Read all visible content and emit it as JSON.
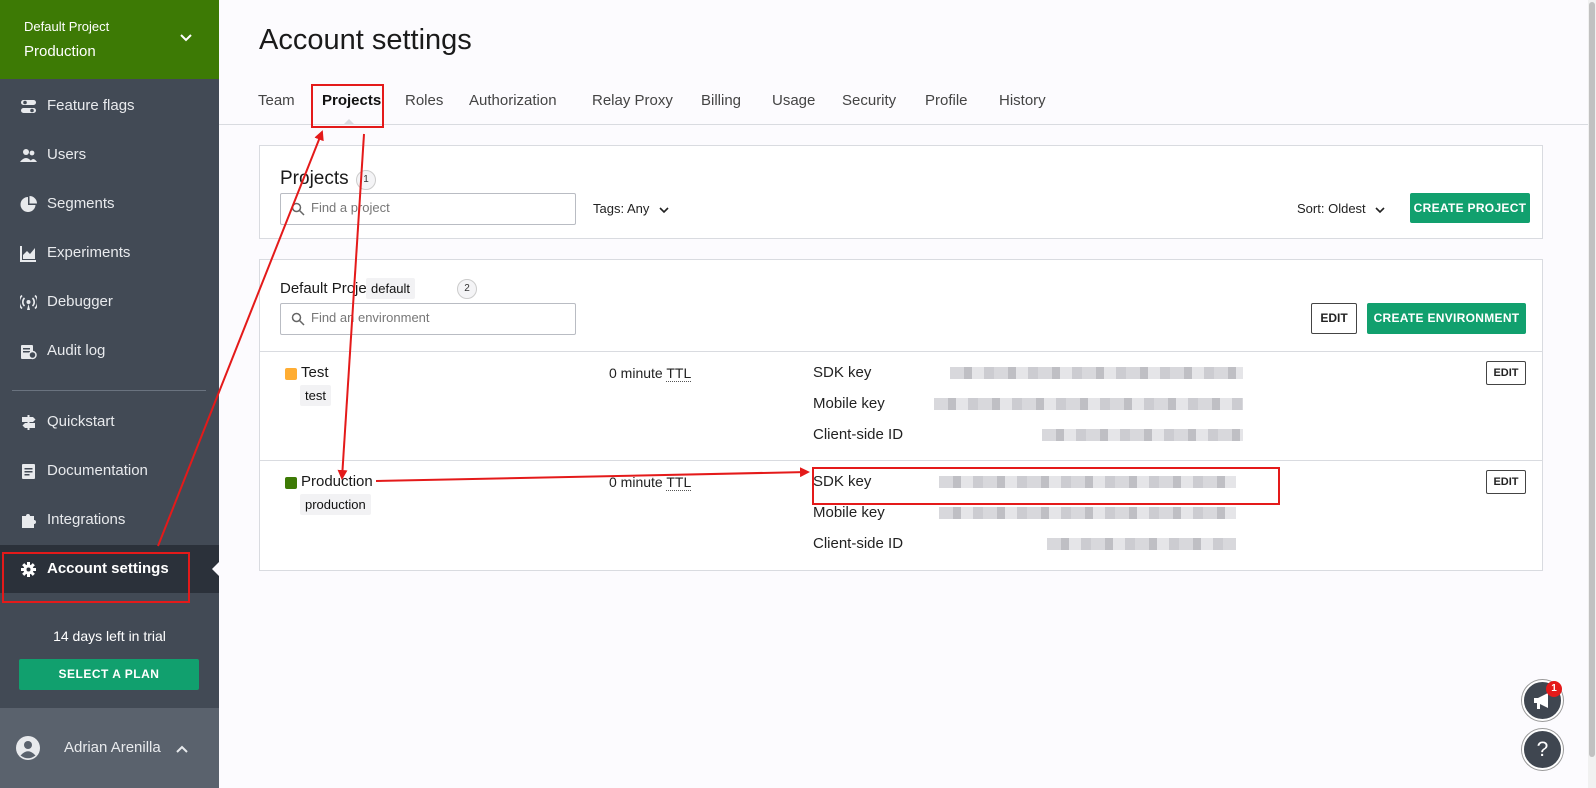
{
  "sidebar": {
    "project_name": "Default Project",
    "environment": "Production",
    "items": [
      {
        "label": "Feature flags",
        "icon": "toggle-icon"
      },
      {
        "label": "Users",
        "icon": "users-icon"
      },
      {
        "label": "Segments",
        "icon": "pie-chart-icon"
      },
      {
        "label": "Experiments",
        "icon": "chart-icon"
      },
      {
        "label": "Debugger",
        "icon": "broadcast-icon"
      },
      {
        "label": "Audit log",
        "icon": "audit-log-icon"
      },
      {
        "label": "Quickstart",
        "icon": "signpost-icon"
      },
      {
        "label": "Documentation",
        "icon": "document-icon"
      },
      {
        "label": "Integrations",
        "icon": "puzzle-icon"
      },
      {
        "label": "Account settings",
        "icon": "gear-icon"
      }
    ],
    "trial_text": "14 days left in trial",
    "select_plan": "SELECT A PLAN",
    "user_name": "Adrian Arenilla"
  },
  "page": {
    "title": "Account settings",
    "tabs": [
      "Team",
      "Projects",
      "Roles",
      "Authorization",
      "Relay Proxy",
      "Billing",
      "Usage",
      "Security",
      "Profile",
      "History"
    ],
    "active_tab": "Projects"
  },
  "projects_card": {
    "heading": "Projects",
    "count": "1",
    "search_placeholder": "Find a project",
    "tags_label": "Tags:",
    "tags_value": "Any",
    "sort_label": "Sort:",
    "sort_value": "Oldest",
    "create_button": "CREATE PROJECT"
  },
  "project": {
    "name": "Default Project",
    "key": "default",
    "env_count": "2",
    "search_placeholder": "Find an environment",
    "edit_button": "EDIT",
    "create_env_button": "CREATE ENVIRONMENT",
    "environments": [
      {
        "name": "Test",
        "key": "test",
        "color": "#ffad33",
        "ttl_prefix": "0 minute",
        "ttl_suffix": "TTL",
        "sdk_key_label": "SDK key",
        "mobile_key_label": "Mobile key",
        "client_id_label": "Client-side ID",
        "edit": "EDIT"
      },
      {
        "name": "Production",
        "key": "production",
        "color": "#3d7a05",
        "ttl_prefix": "0 minute",
        "ttl_suffix": "TTL",
        "sdk_key_label": "SDK key",
        "mobile_key_label": "Mobile key",
        "client_id_label": "Client-side ID",
        "edit": "EDIT"
      }
    ]
  },
  "floating": {
    "notification_count": "1",
    "help": "?"
  },
  "colors": {
    "brand_green": "#3d7a05",
    "button_green": "#11a06e",
    "annotation_red": "#e41a1a",
    "sidebar_bg": "#424a55"
  }
}
